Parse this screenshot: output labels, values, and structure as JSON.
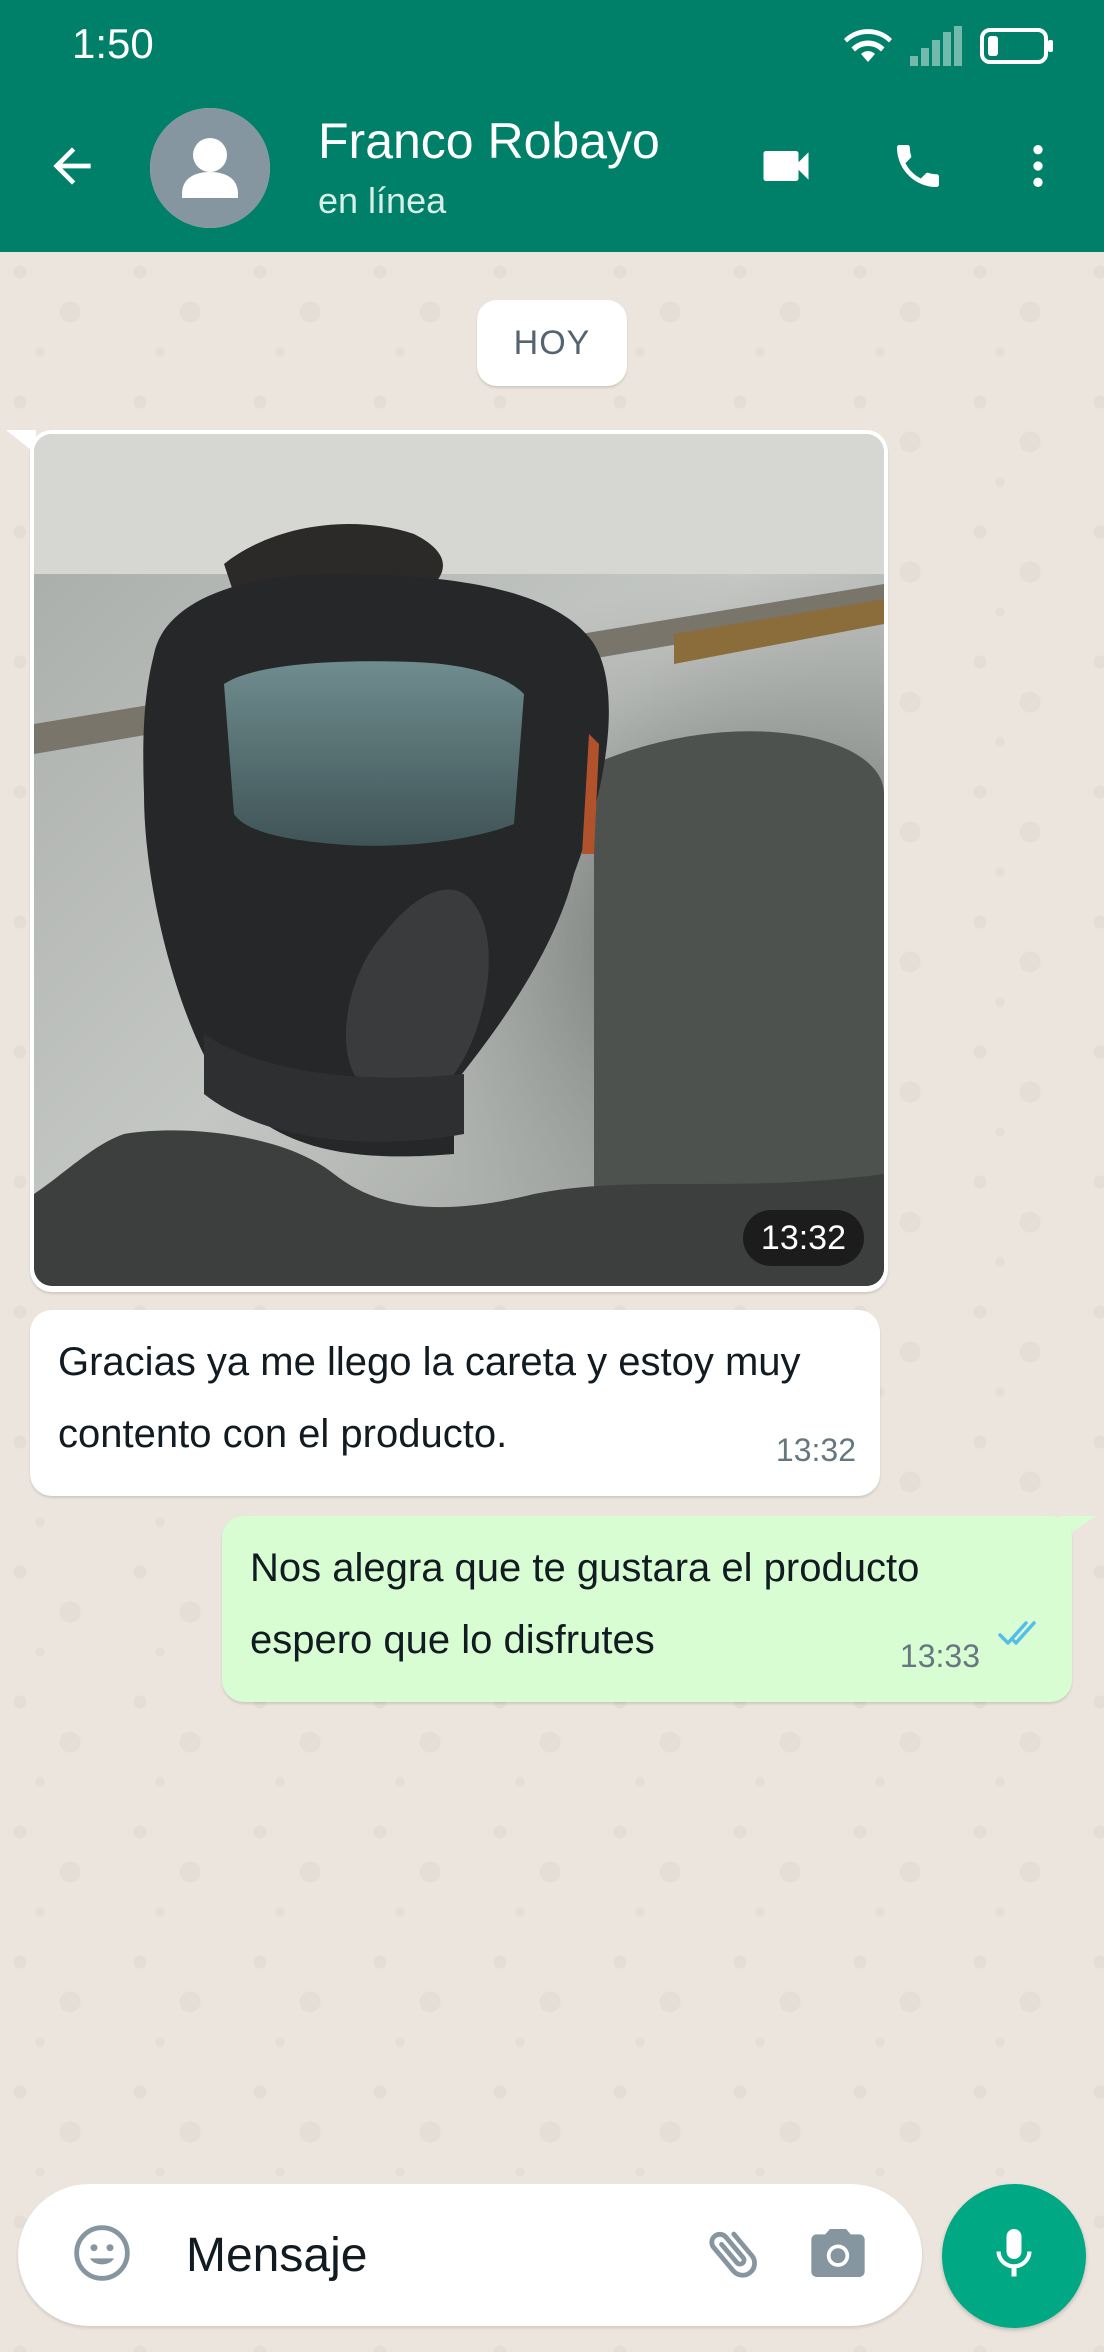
{
  "status_bar": {
    "time": "1:50"
  },
  "header": {
    "contact_name": "Franco Robayo",
    "contact_status": "en línea",
    "icons": [
      "back-arrow-icon",
      "avatar-placeholder-icon",
      "video-call-icon",
      "phone-icon",
      "more-vert-icon"
    ]
  },
  "chat": {
    "date_chip": "HOY",
    "messages": [
      {
        "type": "image",
        "direction": "incoming",
        "time": "13:32"
      },
      {
        "type": "text",
        "direction": "incoming",
        "line1": "Gracias ya me llego la careta y estoy muy",
        "line2": "contento con el producto.",
        "time": "13:32"
      },
      {
        "type": "text",
        "direction": "outgoing",
        "line1": "Nos alegra que te gustara el producto",
        "line2": "espero que lo disfrutes",
        "time": "13:33",
        "status": "read"
      }
    ]
  },
  "composer": {
    "placeholder": "Mensaje"
  },
  "colors": {
    "header": "#008069",
    "chat_background": "#ece5dd",
    "outgoing_bubble": "#d9fdd3",
    "incoming_bubble": "#ffffff",
    "mic_button": "#00a884",
    "read_ticks": "#53bdeb"
  }
}
